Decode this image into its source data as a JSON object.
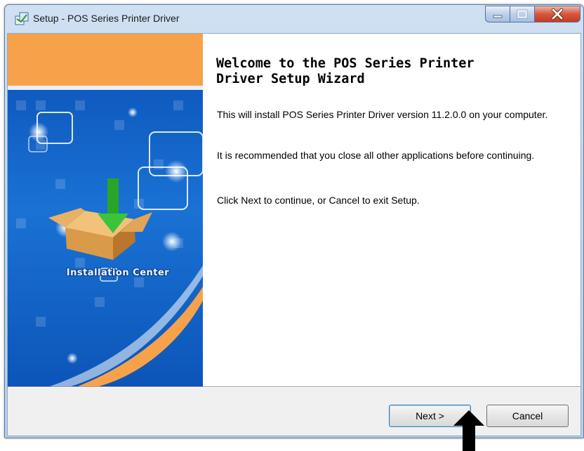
{
  "window": {
    "title": "Setup - POS Series Printer Driver",
    "controls": [
      "minimize",
      "maximize",
      "close"
    ]
  },
  "banner": {
    "logo_text": "Installation Center",
    "colors": {
      "blue": "#1864c4",
      "orange": "#f7a24a"
    }
  },
  "main": {
    "heading": "Welcome to the POS Series Printer\nDriver Setup Wizard",
    "paragraphs": [
      "This will install POS Series Printer Driver version 11.2.0.0 on your computer.",
      "It is recommended that you close all other applications before continuing.",
      "Click Next to continue, or Cancel to exit Setup."
    ]
  },
  "buttons": {
    "next": "Next >",
    "cancel": "Cancel"
  },
  "annotation": {
    "icon": "pointer-arrow-icon",
    "color": "#000000"
  }
}
